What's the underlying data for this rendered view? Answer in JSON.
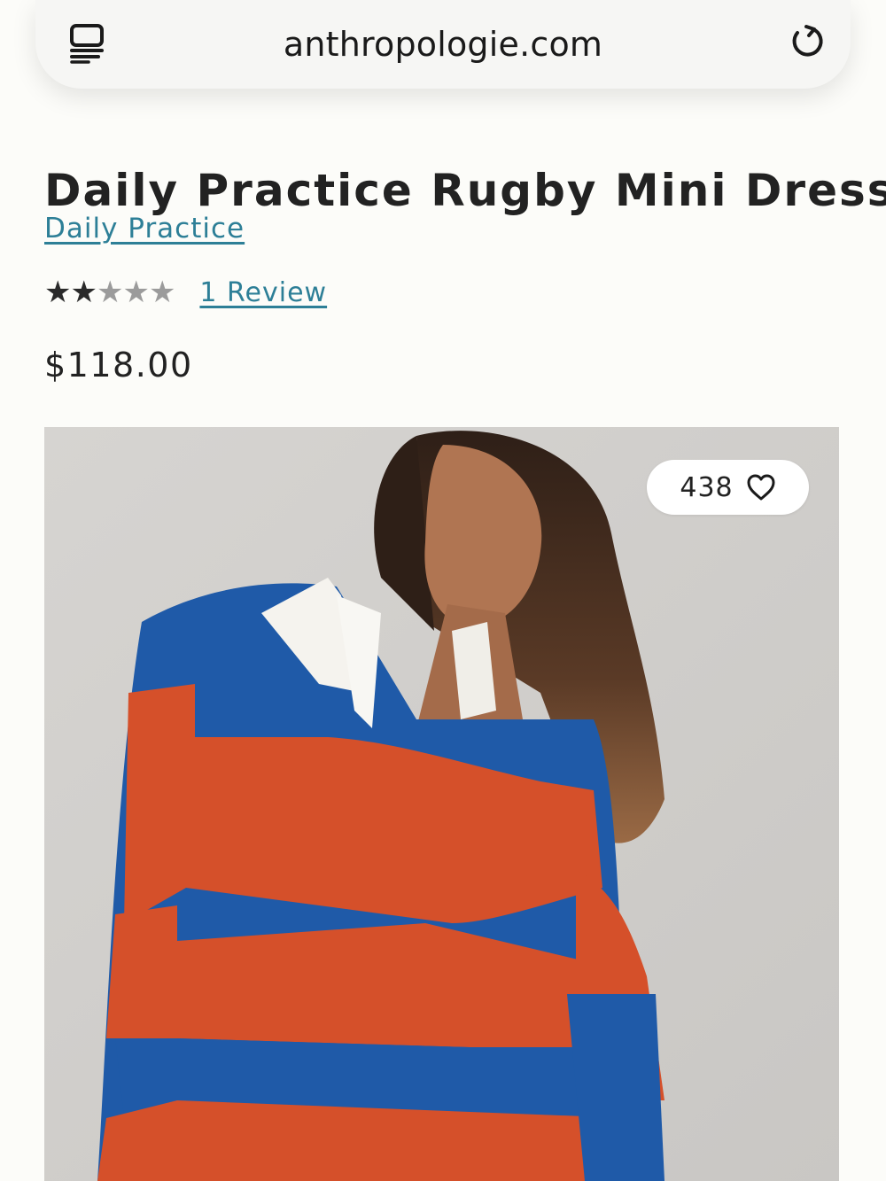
{
  "browser": {
    "url": "anthropologie.com",
    "left_icon": "tabs-icon",
    "right_icon": "reload-icon"
  },
  "product": {
    "title": "Daily Practice Rugby Mini Dress",
    "brand": "Daily Practice",
    "rating": {
      "value": 2,
      "max": 5,
      "review_link": "1 Review"
    },
    "price": "$118.00"
  },
  "image": {
    "like_count": "438",
    "like_icon": "heart-outline-icon"
  },
  "colors": {
    "link": "#2d7f97",
    "stripe_blue": "#1f5aa8",
    "stripe_orange": "#d5502a"
  }
}
